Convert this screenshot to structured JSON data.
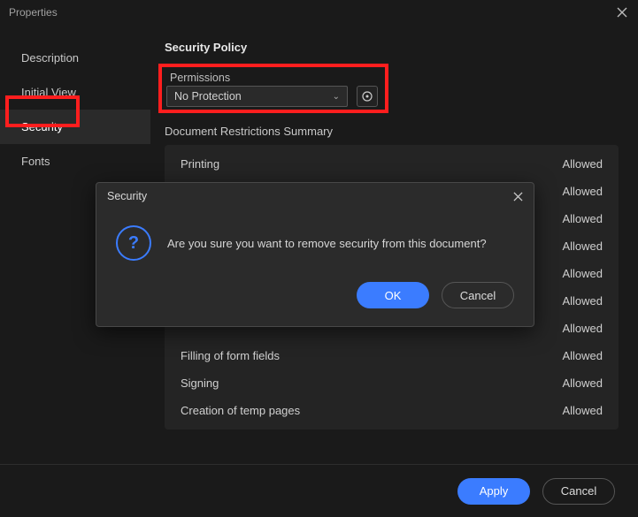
{
  "window": {
    "title": "Properties"
  },
  "sidebar": {
    "items": [
      {
        "label": "Description",
        "active": false
      },
      {
        "label": "Initial View",
        "active": false
      },
      {
        "label": "Security",
        "active": true
      },
      {
        "label": "Fonts",
        "active": false
      }
    ]
  },
  "main": {
    "section_title": "Security Policy",
    "permissions_label": "Permissions",
    "permissions_value": "No Protection",
    "restrictions_heading": "Document Restrictions Summary",
    "restrictions": [
      {
        "label": "Printing",
        "value": "Allowed"
      },
      {
        "label": "",
        "value": "Allowed"
      },
      {
        "label": "",
        "value": "Allowed"
      },
      {
        "label": "",
        "value": "Allowed"
      },
      {
        "label": "",
        "value": "Allowed"
      },
      {
        "label": "",
        "value": "Allowed"
      },
      {
        "label": "",
        "value": "Allowed"
      },
      {
        "label": "Filling of form fields",
        "value": "Allowed"
      },
      {
        "label": "Signing",
        "value": "Allowed"
      },
      {
        "label": "Creation of temp pages",
        "value": "Allowed"
      }
    ]
  },
  "modal": {
    "title": "Security",
    "message": "Are you sure you want to remove security from this document?",
    "ok_label": "OK",
    "cancel_label": "Cancel"
  },
  "footer": {
    "apply_label": "Apply",
    "cancel_label": "Cancel"
  }
}
